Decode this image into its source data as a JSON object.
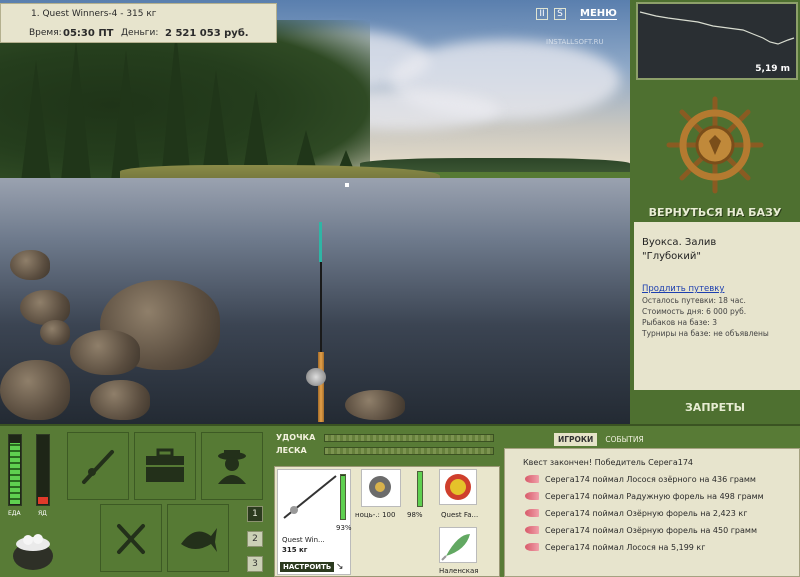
{
  "info": {
    "quest_line": "1. Quest Winners-4 - 315 кг",
    "time_label": "Время:",
    "time_value": "05:30 ПТ",
    "money_label": "Деньги:",
    "money_value": "2 521 053 руб."
  },
  "top_menu": {
    "pause": "II",
    "sound": "S",
    "menu": "МЕНЮ"
  },
  "watermark": "INSTALLSOFT.RU",
  "depth": {
    "value": "5,19 m"
  },
  "right_panel": {
    "return_label": "ВЕРНУТЬСЯ НА БАЗУ",
    "base_name_line1": "Вуокса. Залив",
    "base_name_line2": "\"Глубокий\"",
    "extend_link": "Продлить путевку",
    "remaining": "Осталось путевки: 18 час.",
    "day_cost": "Стоимость дня: 6 000 руб.",
    "fishers": "Рыбаков на базе: 3",
    "tournaments": "Турниры на базе: не объявлены",
    "bans_label": "ЗАПРЕТЫ"
  },
  "gauges": {
    "food_label": "ЕДА",
    "poison_label": "ЯД",
    "food_level": 0.9,
    "poison_level": 0.1,
    "colors": {
      "food": "#5fd050",
      "poison": "#e03a2a"
    }
  },
  "pages": [
    "1",
    "2",
    "3"
  ],
  "tackle": {
    "rod_label": "УДОЧКА",
    "line_label": "ЛЕСКА",
    "rod_name": "Quest Win...",
    "rod_weight": "315 кг",
    "rod_percent": "93%",
    "tune_button": "НАСТРОИТЬ",
    "reel_name": "ноць-.: 100",
    "reel_percent": "98%",
    "bait_name": "Quest Fa...",
    "lure_name": "Наленская"
  },
  "events": {
    "tab_players": "ИГРОКИ",
    "tab_events": "СОБЫТИЯ",
    "items": [
      "Квест закончен! Победитель Серега174",
      "Серега174 поймал Лосося озёрного на 436 грамм",
      "Серега174 поймал Радужную форель на 498 грамм",
      "Серега174 поймал Озёрную форель на 2,423 кг",
      "Серега174 поймал Озёрную форель на 450 грамм",
      "Серега174 поймал Лосося на 5,199 кг"
    ]
  }
}
